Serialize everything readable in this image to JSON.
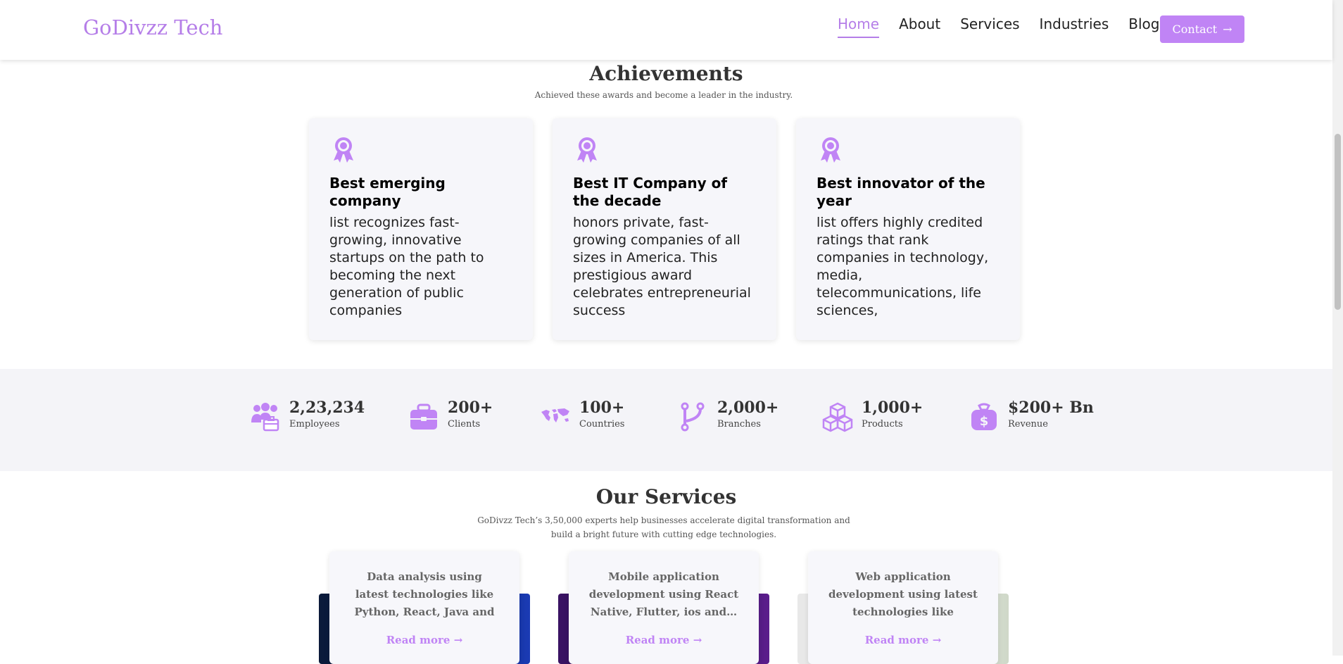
{
  "header": {
    "logo": "GoDivzz Tech",
    "nav": [
      {
        "label": "Home",
        "active": true
      },
      {
        "label": "About",
        "active": false
      },
      {
        "label": "Services",
        "active": false
      },
      {
        "label": "Industries",
        "active": false
      },
      {
        "label": "Blog",
        "active": false
      }
    ],
    "contact_label": "Contact",
    "contact_arrow": "→"
  },
  "achievements": {
    "title": "Achievements",
    "subtitle": "Achieved these awards and become a leader in the industry.",
    "cards": [
      {
        "icon": "award-ribbon-icon",
        "title": "Best emerging company",
        "text": "list recognizes fast-growing, innovative startups on the path to becoming the next generation of public companies"
      },
      {
        "icon": "award-ribbon-icon",
        "title": "Best IT Company of the decade",
        "text": "honors private, fast-growing companies of all sizes in America. This prestigious award celebrates entrepreneurial success"
      },
      {
        "icon": "award-ribbon-icon",
        "title": "Best innovator of the year",
        "text": "list offers highly credited ratings that rank companies in technology, media, telecommunications, life sciences,"
      }
    ]
  },
  "stats": [
    {
      "icon": "employees-icon",
      "value": "2,23,234",
      "label": "Employees"
    },
    {
      "icon": "briefcase-icon",
      "value": "200+",
      "label": "Clients"
    },
    {
      "icon": "world-map-icon",
      "value": "100+",
      "label": "Countries"
    },
    {
      "icon": "branch-icon",
      "value": "2,000+",
      "label": "Branches"
    },
    {
      "icon": "boxes-icon",
      "value": "1,000+",
      "label": "Products"
    },
    {
      "icon": "money-bag-icon",
      "value": "$200+ Bn",
      "label": "Revenue"
    }
  ],
  "services": {
    "title": "Our Services",
    "subtitle": "GoDivzz Tech’s 3,50,000 experts help businesses accelerate digital transformation and build a bright future with cutting edge technologies.",
    "cards": [
      {
        "text": "Data analysis using latest technologies like Python, React, Java and other…",
        "read_more": "Read more",
        "arrow": "→"
      },
      {
        "text": "Mobile application development using React Native, Flutter, ios and…",
        "read_more": "Read more",
        "arrow": "→"
      },
      {
        "text": "Web application development using latest technologies like ReactJS,…",
        "read_more": "Read more",
        "arrow": "→"
      }
    ]
  },
  "colors": {
    "accent": "#c084f5",
    "logo": "#b57ee8",
    "card_bg": "#f6f6fa",
    "band_bg": "#f4f4f8"
  }
}
